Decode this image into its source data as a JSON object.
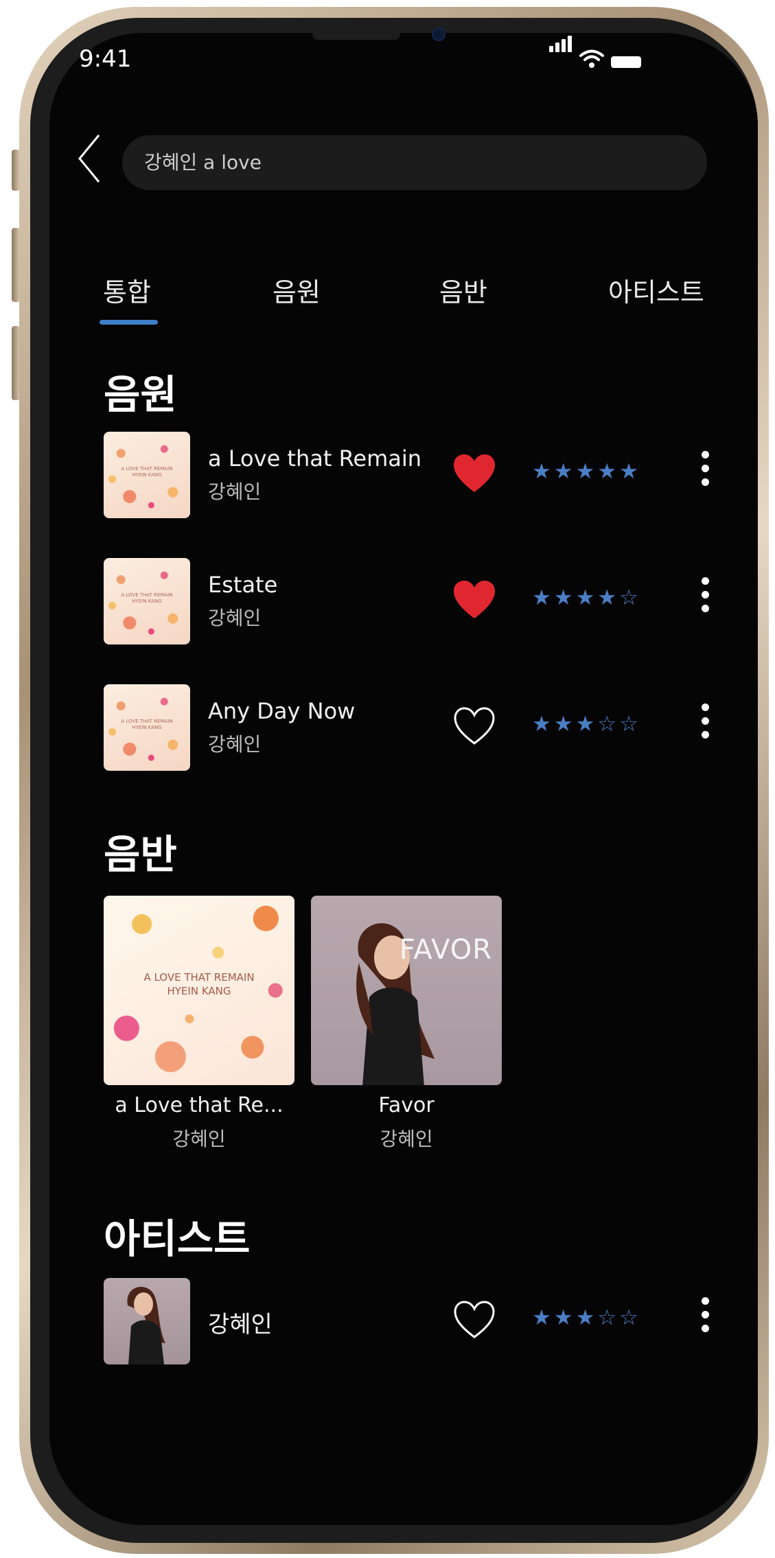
{
  "status_bar": {
    "time": "9:41"
  },
  "search": {
    "value": "강혜인 a love"
  },
  "tabs": [
    {
      "label": "통합",
      "active": true
    },
    {
      "label": "음원",
      "active": false
    },
    {
      "label": "음반",
      "active": false
    },
    {
      "label": "아티스트",
      "active": false
    }
  ],
  "sections": {
    "songs_title": "음원",
    "albums_title": "음반",
    "artists_title": "아티스트"
  },
  "songs": [
    {
      "title": "a Love that Remain",
      "artist": "강혜인",
      "liked": true,
      "rating": 5,
      "rating_stars": "★★★★★",
      "cover_text": "A LOVE THAT REMAIN HYEIN KANG"
    },
    {
      "title": "Estate",
      "artist": "강혜인",
      "liked": true,
      "rating": 4,
      "rating_stars": "★★★★☆",
      "cover_text": "A LOVE THAT REMAIN HYEIN KANG"
    },
    {
      "title": "Any Day Now",
      "artist": "강혜인",
      "liked": false,
      "rating": 3,
      "rating_stars": "★★★☆☆",
      "cover_text": "A LOVE THAT REMAIN HYEIN KANG"
    }
  ],
  "albums": [
    {
      "title": "a Love that Re...",
      "artist": "강혜인",
      "cover_line1": "A LOVE THAT REMAIN",
      "cover_line2": "HYEIN KANG"
    },
    {
      "title": "Favor",
      "artist": "강혜인",
      "cover_word": "FAVOR"
    }
  ],
  "artists": [
    {
      "name": "강혜인",
      "liked": false,
      "rating": 3,
      "rating_stars": "★★★☆☆"
    }
  ],
  "colors": {
    "accent": "#3e7ec8",
    "star": "#4a7fc6",
    "heart_liked": "#e0272f",
    "background": "#050505",
    "search_bg": "#1c1c1c"
  },
  "icons": {
    "back": "chevron-left-icon",
    "heart": "heart-icon",
    "star": "star-icon",
    "more": "more-vertical-icon",
    "signal": "signal-icon",
    "wifi": "wifi-icon",
    "battery": "battery-icon"
  }
}
